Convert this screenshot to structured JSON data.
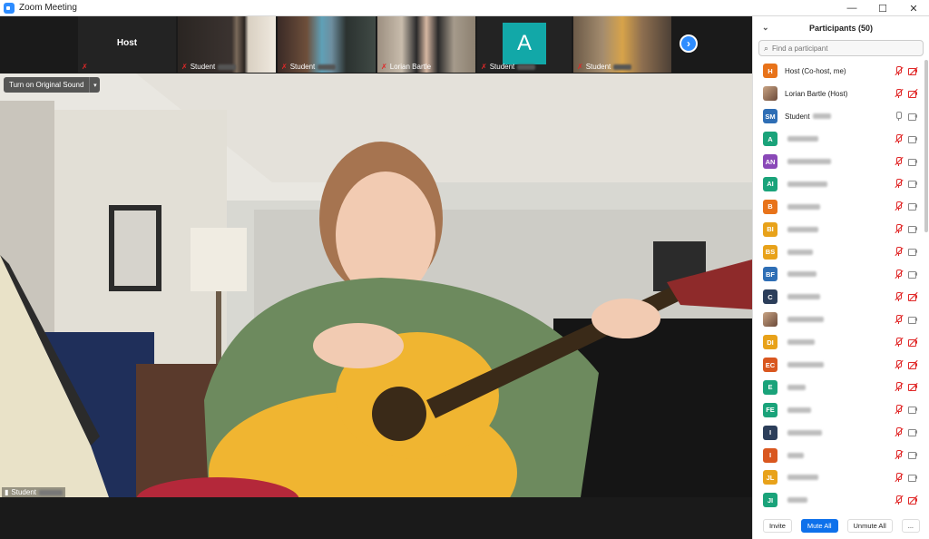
{
  "window": {
    "title": "Zoom Meeting",
    "controls": [
      "—",
      "☐",
      "✕"
    ]
  },
  "strip": {
    "tiles": [
      {
        "label": "Host",
        "name": ""
      },
      {
        "name": "Student"
      },
      {
        "name": "Student"
      },
      {
        "name": "Lorian Bartle"
      },
      {
        "name": "Student",
        "avatar": "A"
      },
      {
        "name": "Student"
      }
    ],
    "next_icon": "›"
  },
  "main": {
    "original_sound": "Turn on Original Sound",
    "original_sound_menu": "▾",
    "speaker": "Student"
  },
  "participants": {
    "title": "Participants (50)",
    "collapse_icon": "⌄",
    "search_placeholder": "Find a participant",
    "search_icon": "⌕",
    "rows": [
      {
        "initials": "H",
        "color": "#e8731a",
        "name": "Host (Co-host, me)",
        "mic": "off",
        "cam": "off"
      },
      {
        "initials": "",
        "color": "photo",
        "name": "Lorian Bartle (Host)",
        "mic": "off",
        "cam": "off"
      },
      {
        "initials": "SM",
        "color": "#2e6eb5",
        "name": "Student",
        "mic": "on",
        "cam": "on"
      },
      {
        "initials": "A",
        "color": "#1aa37a",
        "name": "",
        "mic": "off",
        "cam": "on"
      },
      {
        "initials": "AN",
        "color": "#8a49b8",
        "name": "",
        "mic": "off",
        "cam": "on"
      },
      {
        "initials": "AI",
        "color": "#1aa37a",
        "name": "",
        "mic": "off",
        "cam": "on"
      },
      {
        "initials": "B",
        "color": "#e8731a",
        "name": "",
        "mic": "off",
        "cam": "on"
      },
      {
        "initials": "BI",
        "color": "#e8a21a",
        "name": "",
        "mic": "off",
        "cam": "on"
      },
      {
        "initials": "BS",
        "color": "#e8a21a",
        "name": "",
        "mic": "off",
        "cam": "on"
      },
      {
        "initials": "BF",
        "color": "#2e6eb5",
        "name": "",
        "mic": "off",
        "cam": "on"
      },
      {
        "initials": "C",
        "color": "#2c3e5a",
        "name": "",
        "mic": "off",
        "cam": "off"
      },
      {
        "initials": "",
        "color": "photo",
        "name": "",
        "mic": "off",
        "cam": "on"
      },
      {
        "initials": "DI",
        "color": "#e8a21a",
        "name": "",
        "mic": "off",
        "cam": "off"
      },
      {
        "initials": "EC",
        "color": "#d9571f",
        "name": "",
        "mic": "off",
        "cam": "off"
      },
      {
        "initials": "E",
        "color": "#1aa37a",
        "name": "",
        "mic": "off",
        "cam": "off"
      },
      {
        "initials": "FE",
        "color": "#1aa37a",
        "name": "",
        "mic": "off",
        "cam": "on"
      },
      {
        "initials": "I",
        "color": "#2c3e5a",
        "name": "",
        "mic": "off",
        "cam": "on"
      },
      {
        "initials": "I",
        "color": "#d9571f",
        "name": "",
        "mic": "off",
        "cam": "on"
      },
      {
        "initials": "JL",
        "color": "#e8a21a",
        "name": "",
        "mic": "off",
        "cam": "on"
      },
      {
        "initials": "JI",
        "color": "#1aa37a",
        "name": "",
        "mic": "off",
        "cam": "off"
      }
    ],
    "footer": {
      "invite": "Invite",
      "mute_all": "Mute All",
      "unmute_all": "Unmute All",
      "more": "..."
    }
  }
}
